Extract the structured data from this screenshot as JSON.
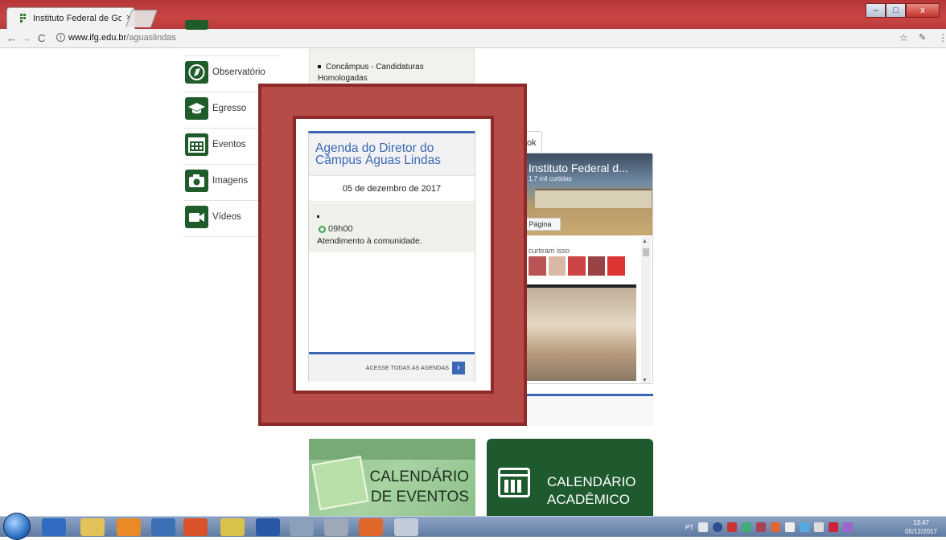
{
  "browser": {
    "tab_title": "Instituto Federal de Goiá",
    "tab_close": "×",
    "url_host": "www.ifg.edu.br",
    "url_path": "/aguaslindas",
    "back": "←",
    "forward": "→",
    "reload": "C",
    "info": "i",
    "star": "☆",
    "window_min": "–",
    "window_max": "□",
    "window_close": "x"
  },
  "sidebar": {
    "items": [
      {
        "label": "Observatório",
        "icon": "compass-icon"
      },
      {
        "label": "Egresso",
        "icon": "graduation-cap-icon"
      },
      {
        "label": "Eventos",
        "icon": "calendar-icon"
      },
      {
        "label": "Imagens",
        "icon": "camera-icon"
      },
      {
        "label": "Vídeos",
        "icon": "video-camera-icon"
      }
    ]
  },
  "news": {
    "item": "Concâmpus - Candidaturas Homologadas"
  },
  "agenda": {
    "title": "Agenda do Diretor do Câmpus Águas Lindas",
    "date": "05 de dezembro de 2017",
    "time": "09h00",
    "description": "Atendimento à comunidade.",
    "link": "ACESSE TODAS AS AGENDAS",
    "go": "›"
  },
  "facebook": {
    "tab_label": "ok",
    "page_name": "Instituto Federal d...",
    "likes": "1,7 mil curtidas",
    "page_button": "r Página",
    "liked_text": "curtiram isso"
  },
  "banners": {
    "eventos_line1": "CALENDÁRIO",
    "eventos_line2": "DE EVENTOS",
    "academico_line1": "CALENDÁRIO",
    "academico_line2": "ACADÊMICO"
  },
  "taskbar": {
    "lang": "PT",
    "time": "13:47",
    "date": "05/12/2017"
  },
  "colors": {
    "overlay": "#b74b48",
    "accent_blue": "#3a68b3",
    "brand_green": "#1f5c2a"
  }
}
